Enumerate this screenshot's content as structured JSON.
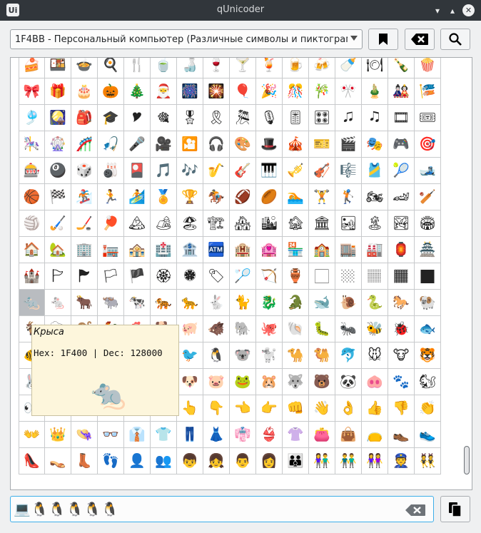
{
  "window": {
    "title": "qUnicoder",
    "app_icon_text": "Ui",
    "icons": [
      "app-icon",
      "minimize-icon",
      "maximize-icon",
      "close-icon"
    ]
  },
  "toolbar": {
    "block_selector_value": "1F4BB - Персональный компьютер (Различные символы и пиктограммы)",
    "icons": [
      "bookmark-icon",
      "clear-icon",
      "search-icon"
    ]
  },
  "grid": {
    "rows": [
      [
        "🍰",
        "🍱",
        "🍲",
        "🍳",
        "🍴",
        "🍵",
        "🍶",
        "🍷",
        "🍸",
        "🍹",
        "🍺",
        "🍻",
        "🍼",
        "🍽",
        "🍾",
        "🍿"
      ],
      [
        "🎀",
        "🎁",
        "🎂",
        "🎃",
        "🎄",
        "🎅",
        "🎆",
        "🎇",
        "🎈",
        "🎉",
        "🎊",
        "🎋",
        "🎌",
        "🎍",
        "🎎",
        "🎏"
      ],
      [
        "🎐",
        "🎑",
        "🎒",
        "🎓",
        "🎔",
        "🎕",
        "🎖",
        "🎗",
        "🎘",
        "🎙",
        "🎚",
        "🎛",
        "🎜",
        "🎝",
        "🎞",
        "🎟"
      ],
      [
        "🎠",
        "🎡",
        "🎢",
        "🎣",
        "🎤",
        "🎥",
        "🎦",
        "🎧",
        "🎨",
        "🎩",
        "🎪",
        "🎫",
        "🎬",
        "🎭",
        "🎮",
        "🎯"
      ],
      [
        "🎰",
        "🎱",
        "🎲",
        "🎳",
        "🎴",
        "🎵",
        "🎶",
        "🎷",
        "🎸",
        "🎹",
        "🎺",
        "🎻",
        "🎼",
        "🎽",
        "🎾",
        "🎿"
      ],
      [
        "🏀",
        "🏁",
        "🏂",
        "🏃",
        "🏄",
        "🏅",
        "🏆",
        "🏇",
        "🏈",
        "🏉",
        "🏊",
        "🏋",
        "🏌",
        "🏍",
        "🏎",
        "🏏"
      ],
      [
        "🏐",
        "🏑",
        "🏒",
        "🏓",
        "🏔",
        "🏕",
        "🏖",
        "🏗",
        "🏘",
        "🏙",
        "🏚",
        "🏛",
        "🏜",
        "🏝",
        "🏞",
        "🏟"
      ],
      [
        "🏠",
        "🏡",
        "🏢",
        "🏣",
        "🏤",
        "🏥",
        "🏦",
        "🏧",
        "🏨",
        "🏩",
        "🏪",
        "🏫",
        "🏬",
        "🏭",
        "🏮",
        "🏯"
      ],
      [
        "🏰",
        "🏱",
        "🏲",
        "🏳",
        "🏴",
        "🏵",
        "🏶",
        "🏷",
        "🏸",
        "🏹",
        "🏺",
        "🏻",
        "🏼",
        "🏽",
        "🏾",
        "🏿"
      ],
      [
        "🐀",
        "🐁",
        "🐂",
        "🐃",
        "🐄",
        "🐅",
        "🐆",
        "🐇",
        "🐈",
        "🐉",
        "🐊",
        "🐋",
        "🐌",
        "🐍",
        "🐎",
        "🐏"
      ],
      [
        "🐐",
        "🐑",
        "🐒",
        "🐓",
        "🐔",
        "🐕",
        "🐖",
        "🐗",
        "🐘",
        "🐙",
        "🐚",
        "🐛",
        "🐜",
        "🐝",
        "🐞",
        "🐟"
      ],
      [
        "🐠",
        "🐡",
        "🐢",
        "🐣",
        "🐤",
        "🐥",
        "🐦",
        "🐧",
        "🐨",
        "🐩",
        "🐪",
        "🐫",
        "🐬",
        "🐭",
        "🐮",
        "🐯"
      ],
      [
        "🐰",
        "🐱",
        "🐲",
        "🐳",
        "🐴",
        "🐵",
        "🐶",
        "🐷",
        "🐸",
        "🐹",
        "🐺",
        "🐻",
        "🐼",
        "🐽",
        "🐾",
        "🐿"
      ],
      [
        "👀",
        "👁",
        "👂",
        "👃",
        "👄",
        "👅",
        "👆",
        "👇",
        "👈",
        "👉",
        "👊",
        "👋",
        "👌",
        "👍",
        "👎",
        "👏"
      ],
      [
        "👐",
        "👑",
        "👒",
        "👓",
        "👔",
        "👕",
        "👖",
        "👗",
        "👘",
        "👙",
        "👚",
        "👛",
        "👜",
        "👝",
        "👞",
        "👟"
      ],
      [
        "👠",
        "👡",
        "👢",
        "👣",
        "👤",
        "👥",
        "👦",
        "👧",
        "👨",
        "👩",
        "👪",
        "👫",
        "👬",
        "👭",
        "👮",
        "👯"
      ]
    ],
    "selected_row": 9,
    "selected_col": 0
  },
  "tooltip": {
    "name": "Крыса",
    "codes": "Hex: 1F400 | Dec: 128000",
    "glyph": "🐀"
  },
  "output": {
    "value": "💻🐧🐧🐧🐧🐧",
    "icons": [
      "clear-input-icon",
      "copy-icon"
    ]
  }
}
